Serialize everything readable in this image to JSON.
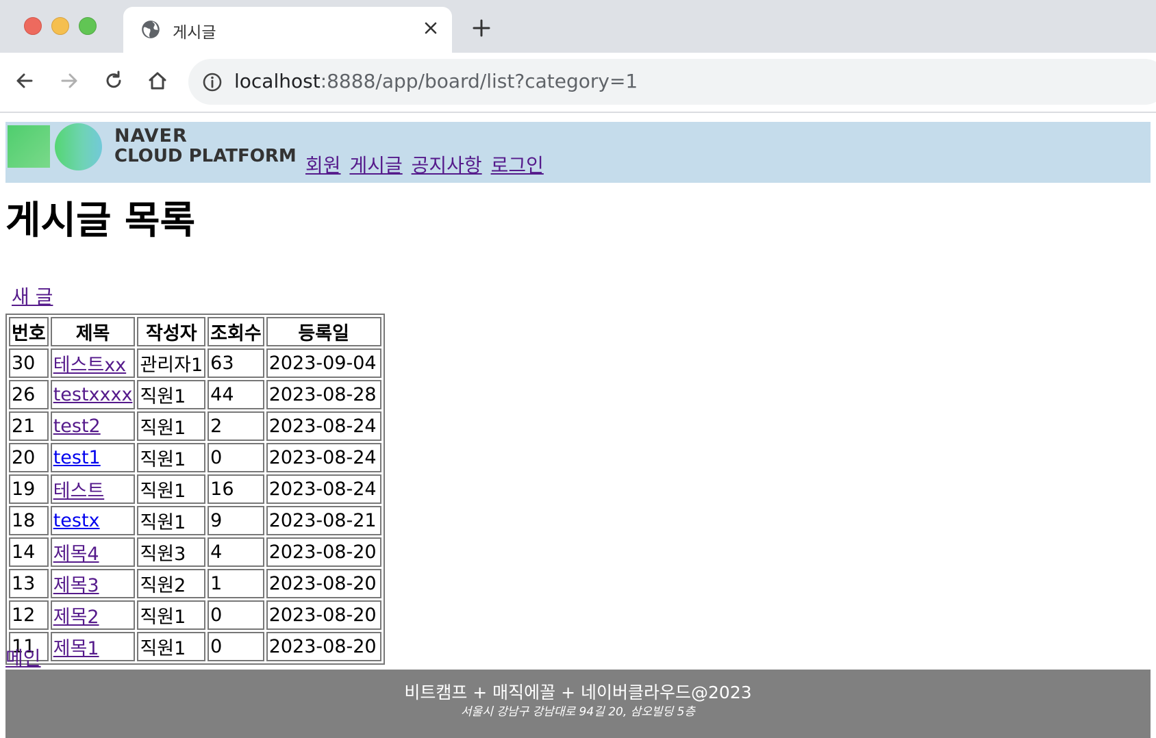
{
  "browser": {
    "tab_title": "게시글",
    "url_host": "localhost",
    "url_path": ":8888/app/board/list?category=1"
  },
  "header": {
    "logo_line1": "NAVER",
    "logo_line2": "CLOUD PLATFORM",
    "menu": [
      "회원",
      "게시글",
      "공지사항",
      "로그인"
    ]
  },
  "page": {
    "title": "게시글 목록",
    "new_post_link": "새 글",
    "main_link": "메인"
  },
  "table": {
    "columns": [
      "번호",
      "제목",
      "작성자",
      "조회수",
      "등록일"
    ],
    "rows": [
      {
        "no": "30",
        "title": "테스트xx",
        "writer": "관리자1",
        "views": "63",
        "date": "2023-09-04",
        "visited": true
      },
      {
        "no": "26",
        "title": "testxxxx",
        "writer": "직원1",
        "views": "44",
        "date": "2023-08-28",
        "visited": true
      },
      {
        "no": "21",
        "title": "test2",
        "writer": "직원1",
        "views": "2",
        "date": "2023-08-24",
        "visited": true
      },
      {
        "no": "20",
        "title": "test1",
        "writer": "직원1",
        "views": "0",
        "date": "2023-08-24",
        "visited": false
      },
      {
        "no": "19",
        "title": "테스트",
        "writer": "직원1",
        "views": "16",
        "date": "2023-08-24",
        "visited": true
      },
      {
        "no": "18",
        "title": "testx",
        "writer": "직원1",
        "views": "9",
        "date": "2023-08-21",
        "visited": false
      },
      {
        "no": "14",
        "title": "제목4",
        "writer": "직원3",
        "views": "4",
        "date": "2023-08-20",
        "visited": true
      },
      {
        "no": "13",
        "title": "제목3",
        "writer": "직원2",
        "views": "1",
        "date": "2023-08-20",
        "visited": true
      },
      {
        "no": "12",
        "title": "제목2",
        "writer": "직원1",
        "views": "0",
        "date": "2023-08-20",
        "visited": true
      },
      {
        "no": "11",
        "title": "제목1",
        "writer": "직원1",
        "views": "0",
        "date": "2023-08-20",
        "visited": true
      }
    ]
  },
  "footer": {
    "line1": "비트캠프 + 매직에꼴 + 네이버클라우드@2023",
    "line2": "서울시 강남구 강남대로 94길 20, 삼오빌딩 5층"
  },
  "colors": {
    "header_bg": "#c5dceb",
    "footer_bg": "#808080",
    "visited_link": "#551a8b",
    "unvisited_link": "#0000ee"
  }
}
